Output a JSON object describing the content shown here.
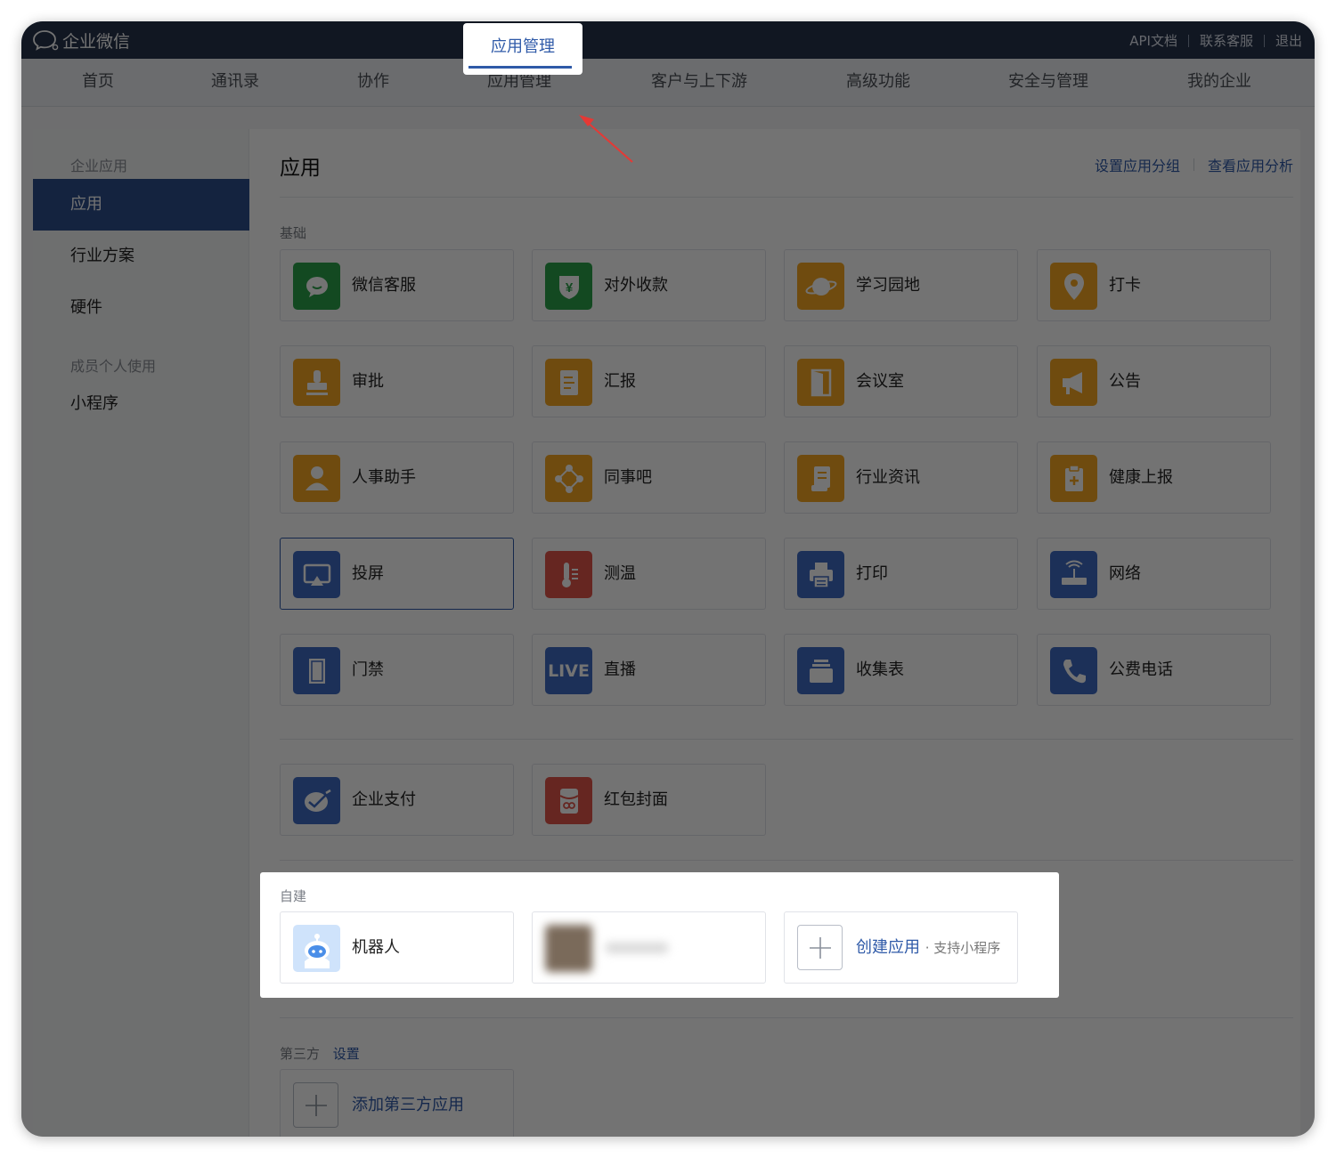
{
  "topbar": {
    "logo_text": "企业微信",
    "links": [
      "API文档",
      "联系客服",
      "退出"
    ]
  },
  "nav": {
    "tabs": [
      "首页",
      "通讯录",
      "协作",
      "应用管理",
      "客户与上下游",
      "高级功能",
      "安全与管理",
      "我的企业"
    ],
    "active": "应用管理"
  },
  "sidebar": {
    "group1": "企业应用",
    "items": [
      "应用",
      "行业方案",
      "硬件"
    ],
    "group2": "成员个人使用",
    "items2": [
      "小程序"
    ]
  },
  "main": {
    "title": "应用",
    "links": [
      "设置应用分组",
      "查看应用分析"
    ],
    "section_basic": "基础",
    "apps": [
      {
        "name": "微信客服",
        "icon": "wechat-service-icon",
        "color": "#2aa34a"
      },
      {
        "name": "对外收款",
        "icon": "payment-shield-icon",
        "color": "#2aa34a"
      },
      {
        "name": "学习园地",
        "icon": "planet-icon",
        "color": "#f5a623"
      },
      {
        "name": "打卡",
        "icon": "location-pin-icon",
        "color": "#f5a623"
      },
      {
        "name": "审批",
        "icon": "stamp-icon",
        "color": "#f5a623"
      },
      {
        "name": "汇报",
        "icon": "report-doc-icon",
        "color": "#f5a623"
      },
      {
        "name": "会议室",
        "icon": "door-icon",
        "color": "#f5a623"
      },
      {
        "name": "公告",
        "icon": "megaphone-icon",
        "color": "#f5a623"
      },
      {
        "name": "人事助手",
        "icon": "person-icon",
        "color": "#f5a623"
      },
      {
        "name": "同事吧",
        "icon": "network-icon",
        "color": "#f5a623"
      },
      {
        "name": "行业资讯",
        "icon": "news-icon",
        "color": "#f5a623"
      },
      {
        "name": "健康上报",
        "icon": "health-clipboard-icon",
        "color": "#f5a623"
      },
      {
        "name": "投屏",
        "icon": "screen-cast-icon",
        "color": "#3f6bc4"
      },
      {
        "name": "测温",
        "icon": "thermometer-icon",
        "color": "#e2554a"
      },
      {
        "name": "打印",
        "icon": "printer-icon",
        "color": "#3f6bc4"
      },
      {
        "name": "网络",
        "icon": "router-icon",
        "color": "#3f6bc4"
      },
      {
        "name": "门禁",
        "icon": "door-panel-icon",
        "color": "#3f6bc4"
      },
      {
        "name": "直播",
        "icon": "live-icon",
        "color": "#3f6bc4"
      },
      {
        "name": "收集表",
        "icon": "form-stack-icon",
        "color": "#3f6bc4"
      },
      {
        "name": "公费电话",
        "icon": "phone-icon",
        "color": "#3f6bc4"
      }
    ],
    "live_text": "LIVE",
    "apps2": [
      {
        "name": "企业支付",
        "icon": "enterprise-pay-icon",
        "color": "#3f6bc4"
      },
      {
        "name": "红包封面",
        "icon": "red-envelope-icon",
        "color": "#e2554a"
      }
    ],
    "section_custom": "自建",
    "custom_apps": [
      {
        "name": "机器人",
        "icon": "robot-icon"
      }
    ],
    "create": {
      "label": "创建应用",
      "sub": "· 支持小程序"
    },
    "section_third": "第三方",
    "third_settings": "设置",
    "add_third": "添加第三方应用"
  }
}
